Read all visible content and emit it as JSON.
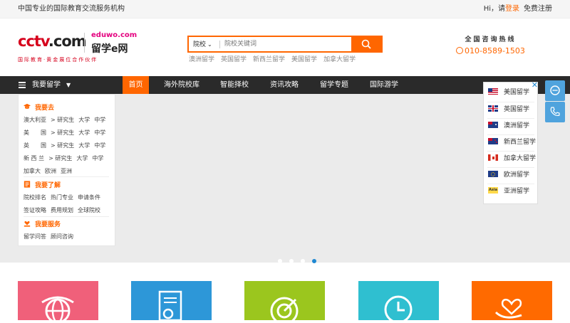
{
  "topbar": {
    "slogan": "中国专业的国际教育交流服务机构",
    "greeting": "Hi，请",
    "login": "登录",
    "register": "免费注册"
  },
  "logo": {
    "cctv": "CCTV.com",
    "eduwo": "eduwo.com",
    "eduwo_name": "留学e网",
    "tagline": "国际教育·黄金展位合作伙伴"
  },
  "search": {
    "scope": "院校",
    "placeholder": "院校关键词",
    "hot_links": [
      "澳洲留学",
      "英国留学",
      "新西兰留学",
      "美国留学",
      "加拿大留学"
    ]
  },
  "hotline": {
    "title": "全国咨询热线",
    "number": "010-8589-1503"
  },
  "nav": {
    "category_label": "我要留学",
    "items": [
      "首页",
      "海外院校库",
      "智能择校",
      "资讯攻略",
      "留学专题",
      "国际游学"
    ]
  },
  "menu": {
    "go_title": "我要去",
    "go_rows": [
      [
        "澳大利亚",
        "> 研究生",
        "大学",
        "中学"
      ],
      [
        "美　　国",
        "> 研究生",
        "大学",
        "中学"
      ],
      [
        "英　　国",
        "> 研究生",
        "大学",
        "中学"
      ],
      [
        "新 西 兰",
        "> 研究生",
        "大学",
        "中学"
      ],
      [
        "加拿大",
        "欧洲",
        "亚洲"
      ]
    ],
    "know_title": "我要了解",
    "know_rows": [
      [
        "院校排名",
        "热门专业",
        "申请条件"
      ],
      [
        "签证攻略",
        "费用规划",
        "全球院校"
      ]
    ],
    "service_title": "我要服务",
    "service_rows": [
      [
        "留学问答",
        "顾问咨询"
      ]
    ]
  },
  "flags": [
    "美国留学",
    "英国留学",
    "澳洲留学",
    "新西兰留学",
    "加拿大留学",
    "欧洲留学",
    "亚洲留学"
  ],
  "flag_badge_asia": "Asia",
  "banner_slides": 4,
  "banner_active_slide": 4,
  "colors": {
    "accent": "#ff6600",
    "nav_bg": "#2a2a2a",
    "card_colors": [
      "#f0607a",
      "#2d97d8",
      "#9bc61e",
      "#2fbfd0",
      "#ff6a00"
    ]
  },
  "icons": {
    "search": "search-icon",
    "phone": "phone-icon",
    "side_service": "customer-service-icon",
    "side_phone": "phone-call-icon"
  }
}
